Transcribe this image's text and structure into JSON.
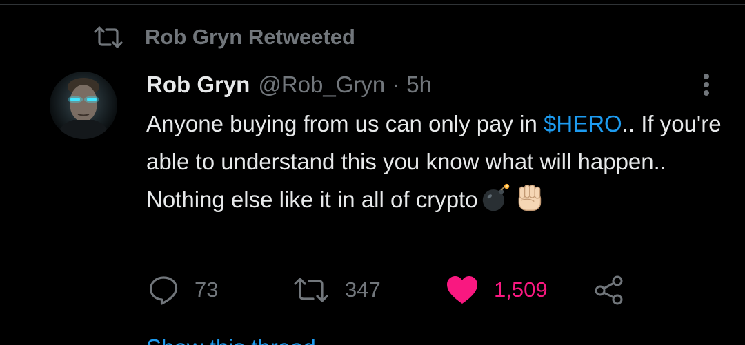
{
  "retweet_context": {
    "label": "Rob Gryn Retweeted",
    "icon": "retweet-icon"
  },
  "author": {
    "name": "Rob Gryn",
    "handle": "@Rob_Gryn",
    "separator": "·",
    "time": "5h"
  },
  "tweet": {
    "text_before": "Anyone buying from us can only pay in ",
    "cashtag": "$HERO",
    "text_after": ".. If you're able to understand this you know what will happen.. Nothing else like it in all of crypto",
    "emojis": [
      "bomb-emoji",
      "raised-fist-emoji"
    ]
  },
  "actions": {
    "reply": {
      "icon": "reply-icon",
      "count": "73"
    },
    "retweet": {
      "icon": "retweet-icon",
      "count": "347"
    },
    "like": {
      "icon": "heart-icon",
      "count": "1,509",
      "liked": true
    },
    "share": {
      "icon": "share-icon"
    }
  },
  "show_thread": "Show this thread",
  "colors": {
    "accent": "#1d9bf0",
    "like": "#f91880",
    "muted": "#71767b",
    "text": "#e7e9ea",
    "background": "#000000"
  }
}
